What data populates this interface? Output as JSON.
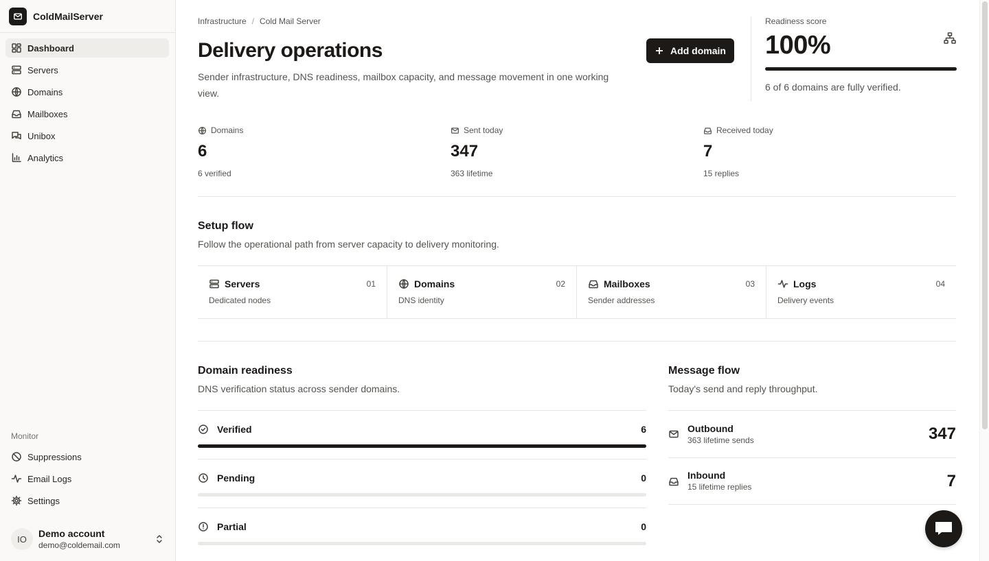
{
  "brand": {
    "name": "ColdMailServer",
    "icon": "mail-icon"
  },
  "nav": [
    {
      "label": "Dashboard",
      "icon": "dashboard-icon",
      "active": true
    },
    {
      "label": "Servers",
      "icon": "server-icon"
    },
    {
      "label": "Domains",
      "icon": "globe-icon"
    },
    {
      "label": "Mailboxes",
      "icon": "inbox-icon"
    },
    {
      "label": "Unibox",
      "icon": "messages-icon"
    },
    {
      "label": "Analytics",
      "icon": "chart-icon"
    }
  ],
  "monitor": {
    "heading": "Monitor",
    "items": [
      {
        "label": "Suppressions",
        "icon": "ban-icon"
      },
      {
        "label": "Email Logs",
        "icon": "activity-icon"
      },
      {
        "label": "Settings",
        "icon": "gear-icon"
      }
    ]
  },
  "account": {
    "initials": "IO",
    "name": "Demo account",
    "email": "demo@coldemail.com"
  },
  "breadcrumb": [
    "Infrastructure",
    "Cold Mail Server"
  ],
  "header": {
    "title": "Delivery operations",
    "description": "Sender infrastructure, DNS readiness, mailbox capacity, and message movement in one working view.",
    "add_label": "Add domain"
  },
  "readiness": {
    "label": "Readiness score",
    "score": "100%",
    "fraction": 1.0,
    "note": "6 of 6 domains are fully verified."
  },
  "stats": [
    {
      "label": "Domains",
      "value": "6",
      "sub": "6 verified",
      "icon": "globe-icon"
    },
    {
      "label": "Sent today",
      "value": "347",
      "sub": "363 lifetime",
      "icon": "mail-icon"
    },
    {
      "label": "Received today",
      "value": "7",
      "sub": "15 replies",
      "icon": "inbox-icon"
    }
  ],
  "setup": {
    "title": "Setup flow",
    "description": "Follow the operational path from server capacity to delivery monitoring.",
    "steps": [
      {
        "label": "Servers",
        "num": "01",
        "sub": "Dedicated nodes",
        "icon": "server-icon"
      },
      {
        "label": "Domains",
        "num": "02",
        "sub": "DNS identity",
        "icon": "globe-icon"
      },
      {
        "label": "Mailboxes",
        "num": "03",
        "sub": "Sender addresses",
        "icon": "inbox-icon"
      },
      {
        "label": "Logs",
        "num": "04",
        "sub": "Delivery events",
        "icon": "activity-icon"
      }
    ]
  },
  "domain_readiness": {
    "title": "Domain readiness",
    "description": "DNS verification status across sender domains.",
    "rows": [
      {
        "label": "Verified",
        "count": "6",
        "fraction": 1.0,
        "icon": "check-circle-icon"
      },
      {
        "label": "Pending",
        "count": "0",
        "fraction": 0,
        "icon": "clock-icon"
      },
      {
        "label": "Partial",
        "count": "0",
        "fraction": 0,
        "icon": "alert-circle-icon"
      }
    ]
  },
  "message_flow": {
    "title": "Message flow",
    "description": "Today's send and reply throughput.",
    "rows": [
      {
        "label": "Outbound",
        "sub": "363 lifetime sends",
        "value": "347",
        "icon": "mail-icon"
      },
      {
        "label": "Inbound",
        "sub": "15 lifetime replies",
        "value": "7",
        "icon": "inbox-icon"
      }
    ]
  },
  "colors": {
    "accent": "#1c1917",
    "sidebar_bg": "#faf9f7",
    "border": "#e7e5e4",
    "muted_text": "#57534e"
  }
}
